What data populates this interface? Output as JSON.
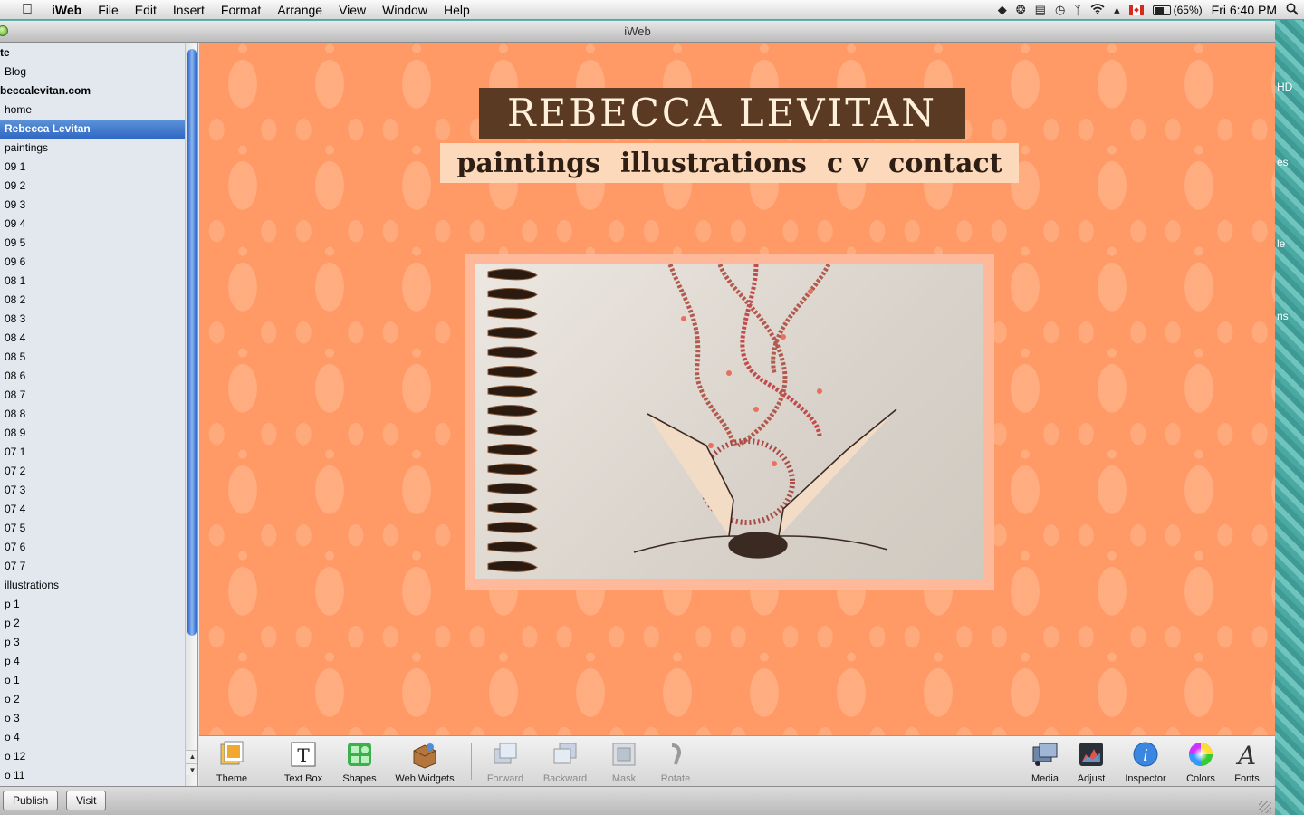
{
  "menubar": {
    "app_name": "iWeb",
    "menus": [
      "File",
      "Edit",
      "Insert",
      "Format",
      "Arrange",
      "View",
      "Window",
      "Help"
    ],
    "battery_percent_label": "(65%)",
    "battery_level": 0.65,
    "clock": "Fri 6:40 PM"
  },
  "window": {
    "title": "iWeb"
  },
  "desktop_fragments": [
    "HD",
    "es",
    "le",
    "ns"
  ],
  "sidebar": {
    "items": [
      {
        "label": "te",
        "kind": "header"
      },
      {
        "label": "Blog",
        "kind": "page"
      },
      {
        "label": "beccalevitan.com",
        "kind": "header"
      },
      {
        "label": "home",
        "kind": "page"
      },
      {
        "label": "Rebecca Levitan",
        "kind": "selected"
      },
      {
        "label": "paintings",
        "kind": "page"
      },
      {
        "label": "09 1",
        "kind": "page"
      },
      {
        "label": "09 2",
        "kind": "page"
      },
      {
        "label": "09 3",
        "kind": "page"
      },
      {
        "label": "09 4",
        "kind": "page"
      },
      {
        "label": "09 5",
        "kind": "page"
      },
      {
        "label": "09 6",
        "kind": "page"
      },
      {
        "label": "08 1",
        "kind": "page"
      },
      {
        "label": "08 2",
        "kind": "page"
      },
      {
        "label": "08 3",
        "kind": "page"
      },
      {
        "label": "08 4",
        "kind": "page"
      },
      {
        "label": "08 5",
        "kind": "page"
      },
      {
        "label": "08 6",
        "kind": "page"
      },
      {
        "label": "08 7",
        "kind": "page"
      },
      {
        "label": "08 8",
        "kind": "page"
      },
      {
        "label": "08 9",
        "kind": "page"
      },
      {
        "label": "07 1",
        "kind": "page"
      },
      {
        "label": "07 2",
        "kind": "page"
      },
      {
        "label": "07 3",
        "kind": "page"
      },
      {
        "label": "07 4",
        "kind": "page"
      },
      {
        "label": "07 5",
        "kind": "page"
      },
      {
        "label": "07 6",
        "kind": "page"
      },
      {
        "label": "07 7",
        "kind": "page"
      },
      {
        "label": "illustrations",
        "kind": "page"
      },
      {
        "label": "p 1",
        "kind": "page"
      },
      {
        "label": "p 2",
        "kind": "page"
      },
      {
        "label": "p 3",
        "kind": "page"
      },
      {
        "label": "p 4",
        "kind": "page"
      },
      {
        "label": "o 1",
        "kind": "page"
      },
      {
        "label": "o 2",
        "kind": "page"
      },
      {
        "label": "o 3",
        "kind": "page"
      },
      {
        "label": "o 4",
        "kind": "page"
      },
      {
        "label": "o 12",
        "kind": "page"
      },
      {
        "label": "o 11",
        "kind": "page"
      }
    ]
  },
  "canvas": {
    "site_title": "REBECCA LEVITAN",
    "nav": [
      "paintings",
      "illustrations",
      "c v",
      "contact"
    ]
  },
  "toolbar": {
    "theme": "Theme",
    "text_box": "Text Box",
    "shapes": "Shapes",
    "web_widgets": "Web Widgets",
    "forward": "Forward",
    "backward": "Backward",
    "mask": "Mask",
    "rotate": "Rotate",
    "media": "Media",
    "adjust": "Adjust",
    "inspector": "Inspector",
    "colors": "Colors",
    "fonts": "Fonts"
  },
  "bottombar": {
    "publish": "Publish",
    "visit": "Visit"
  },
  "colors": {
    "canvas_bg": "#ff9966",
    "title_bg": "#5b3a24",
    "nav_bg": "#fcd9bb",
    "selection": "#3068c5"
  }
}
